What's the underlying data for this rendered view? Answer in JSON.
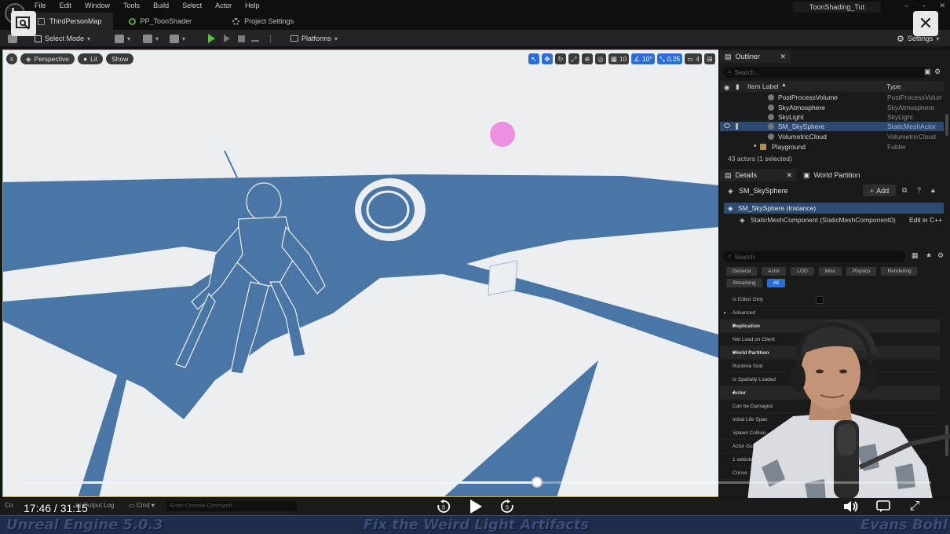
{
  "menu": [
    "File",
    "Edit",
    "Window",
    "Tools",
    "Build",
    "Select",
    "Actor",
    "Help"
  ],
  "tabs": [
    {
      "label": "ThirdPersonMap",
      "active": true,
      "icon": "map-icon"
    },
    {
      "label": "PP_ToonShader",
      "active": false,
      "icon": "material-icon"
    },
    {
      "label": "Project Settings",
      "active": false,
      "icon": "gear-icon"
    }
  ],
  "project_name": "ToonShading_Tut",
  "toolbar": {
    "select_mode": "Select Mode",
    "platforms": "Platforms",
    "settings": "Settings"
  },
  "viewport": {
    "perspective": "Perspective",
    "lit": "Lit",
    "show": "Show",
    "grid_snap": "10",
    "rotation_snap": "10°",
    "scale_snap": "0,25",
    "camera_speed": "4",
    "shadow_color": "#4a76a6",
    "light_color": "#ebeff2"
  },
  "outliner": {
    "tab": "Outliner",
    "search_placeholder": "Search...",
    "col_label": "Item Label",
    "col_type": "Type",
    "rows": [
      {
        "label": "PostProcessVolume",
        "type": "PostProcessVolume",
        "selected": false
      },
      {
        "label": "SkyAtmosphere",
        "type": "SkyAtmosphere",
        "selected": false
      },
      {
        "label": "SkyLight",
        "type": "SkyLight",
        "selected": false
      },
      {
        "label": "SM_SkySphere",
        "type": "StaticMeshActor",
        "selected": true
      },
      {
        "label": "VolumetricCloud",
        "type": "VolumetricCloud",
        "selected": false
      },
      {
        "label": "Playground",
        "type": "Folder",
        "selected": false
      }
    ],
    "status": "43 actors (1 selected)"
  },
  "details": {
    "tab": "Details",
    "tab2": "World Partition",
    "object_name": "SM_SkySphere",
    "add": "Add",
    "instance": "SM_SkySphere (Instance)",
    "component": "StaticMeshComponent (StaticMeshComponent0)",
    "edit_cpp": "Edit in C++",
    "search_placeholder": "Search",
    "filters_row1": [
      "General",
      "Actor",
      "LOD",
      "Misc",
      "Physics",
      "Rendering"
    ],
    "filters_row2": [
      "Streaming",
      "All"
    ],
    "properties": [
      {
        "label": "Is Editor Only",
        "category": false,
        "arrow": ""
      },
      {
        "label": "Advanced",
        "category": false,
        "arrow": "▸"
      },
      {
        "label": "Replication",
        "category": true,
        "arrow": "▾"
      },
      {
        "label": "Net Load on Client",
        "category": false,
        "arrow": ""
      },
      {
        "label": "World Partition",
        "category": true,
        "arrow": "▾"
      },
      {
        "label": "Runtime Grid",
        "category": false,
        "arrow": ""
      },
      {
        "label": "Is Spatially Loaded",
        "category": false,
        "arrow": ""
      },
      {
        "label": "Actor",
        "category": true,
        "arrow": "▾"
      },
      {
        "label": "Can be Damaged",
        "category": false,
        "arrow": ""
      },
      {
        "label": "Initial Life Span",
        "category": false,
        "arrow": ""
      },
      {
        "label": "Spawn Collisio",
        "category": false,
        "arrow": ""
      },
      {
        "label": "Actor Guid",
        "category": false,
        "arrow": ""
      },
      {
        "label": "1 selecte",
        "category": false,
        "arrow": ""
      },
      {
        "label": "Conve",
        "category": false,
        "arrow": ""
      }
    ]
  },
  "bottom": {
    "content": "Co",
    "output_log": "Output Log",
    "cmd": "Cmd",
    "console_placeholder": "Enter Console Command"
  },
  "player": {
    "time": "17:46 / 31:15",
    "progress": 0.568
  },
  "banner": {
    "left": "Unreal Engine 5.0.3",
    "center": "Fix the Weird Light Artifacts",
    "right": "Evans Bohl"
  }
}
